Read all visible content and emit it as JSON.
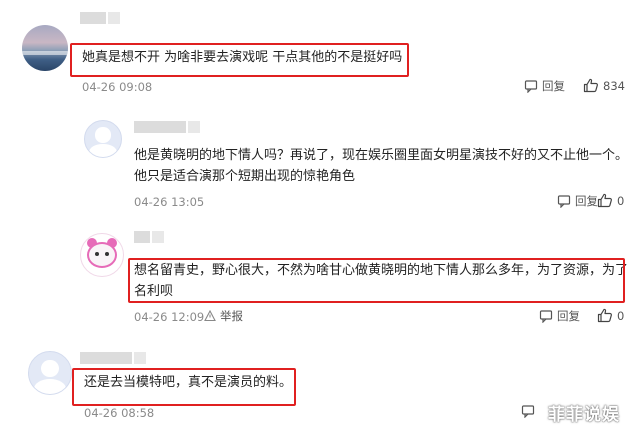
{
  "comments": [
    {
      "text": "她真是想不开 为啥非要去演戏呢 干点其他的不是挺好吗",
      "time": "04-26 09:08",
      "reply_label": "回复",
      "likes": "834"
    },
    {
      "text_line1": "他是黄晓明的地下情人吗？再说了，现在娱乐圈里面女明星演技不好的又不止他一个。",
      "text_line2": "他只是适合演那个短期出现的惊艳角色",
      "time": "04-26 13:05",
      "reply_label": "回复",
      "likes": "0"
    },
    {
      "text_line1": "想名留青史，野心很大，不然为啥甘心做黄晓明的地下情人那么多年，为了资源，为了",
      "text_line2": "名利呗",
      "time": "04-26 12:09",
      "report_label": "举报",
      "reply_label": "回复",
      "likes": "0"
    },
    {
      "text": "还是去当模特吧，真不是演员的料。",
      "time": "04-26 08:58"
    }
  ],
  "watermark": "菲菲说娱",
  "colors": {
    "highlight": "#e02020",
    "meta": "#8a8a8a"
  }
}
